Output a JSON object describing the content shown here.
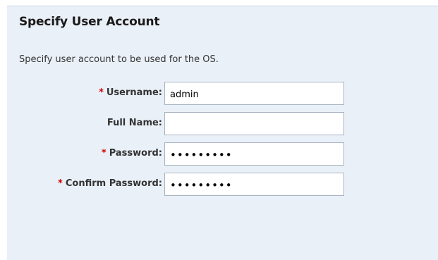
{
  "section": {
    "title": "Specify User Account",
    "description": "Specify user account to be used for the OS."
  },
  "form": {
    "username": {
      "label": "Username:",
      "required_mark": "*",
      "value": "admin"
    },
    "full_name": {
      "label": "Full Name:",
      "value": ""
    },
    "password": {
      "label": "Password:",
      "required_mark": "*",
      "value": "•••••••••"
    },
    "confirm_password": {
      "label": "Confirm Password:",
      "required_mark": "*",
      "value": "•••••••••"
    }
  },
  "colors": {
    "panel_background": "#eaf0f8",
    "required_mark": "#cc0000",
    "input_border": "#a9b4c2"
  }
}
